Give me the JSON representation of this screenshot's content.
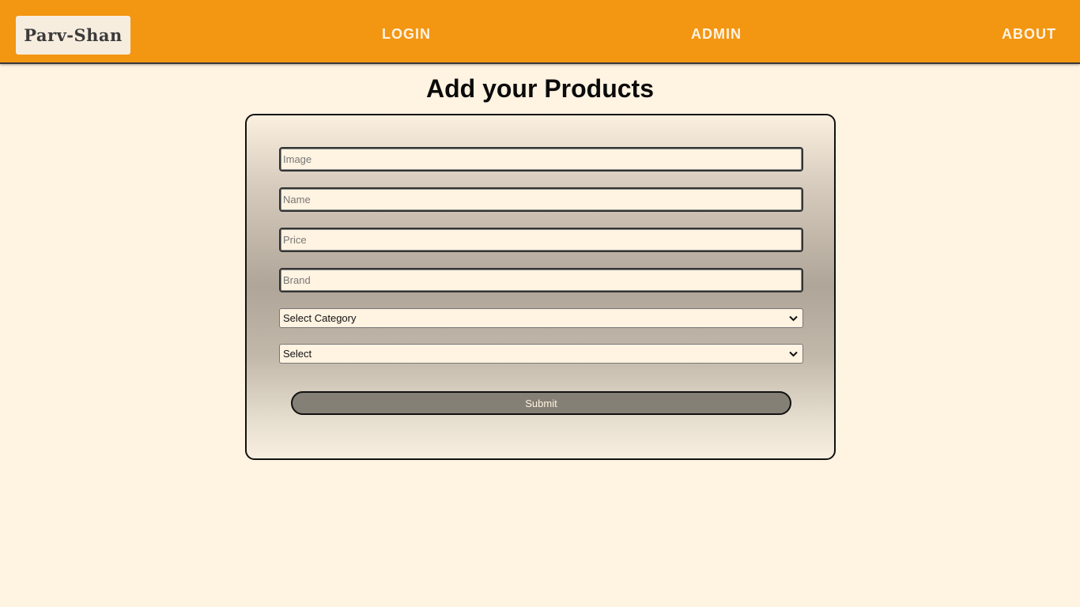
{
  "navbar": {
    "logo_text": "Parv-Shan",
    "links": [
      {
        "label": "LOGIN"
      },
      {
        "label": "ADMIN"
      },
      {
        "label": "ABOUT"
      }
    ],
    "colors": {
      "background": "#f39612",
      "link_text": "#fdf3e4"
    }
  },
  "page": {
    "title": "Add your Products",
    "background": "#fff3e1"
  },
  "form": {
    "fields": {
      "image": {
        "placeholder": "Image",
        "value": ""
      },
      "name": {
        "placeholder": "Name",
        "value": ""
      },
      "price": {
        "placeholder": "Price",
        "value": ""
      },
      "brand": {
        "placeholder": "Brand",
        "value": ""
      }
    },
    "category_select": {
      "selected": "Select Category"
    },
    "sub_select": {
      "selected": "Select"
    },
    "submit_label": "Submit",
    "submit_color": "#858075"
  }
}
